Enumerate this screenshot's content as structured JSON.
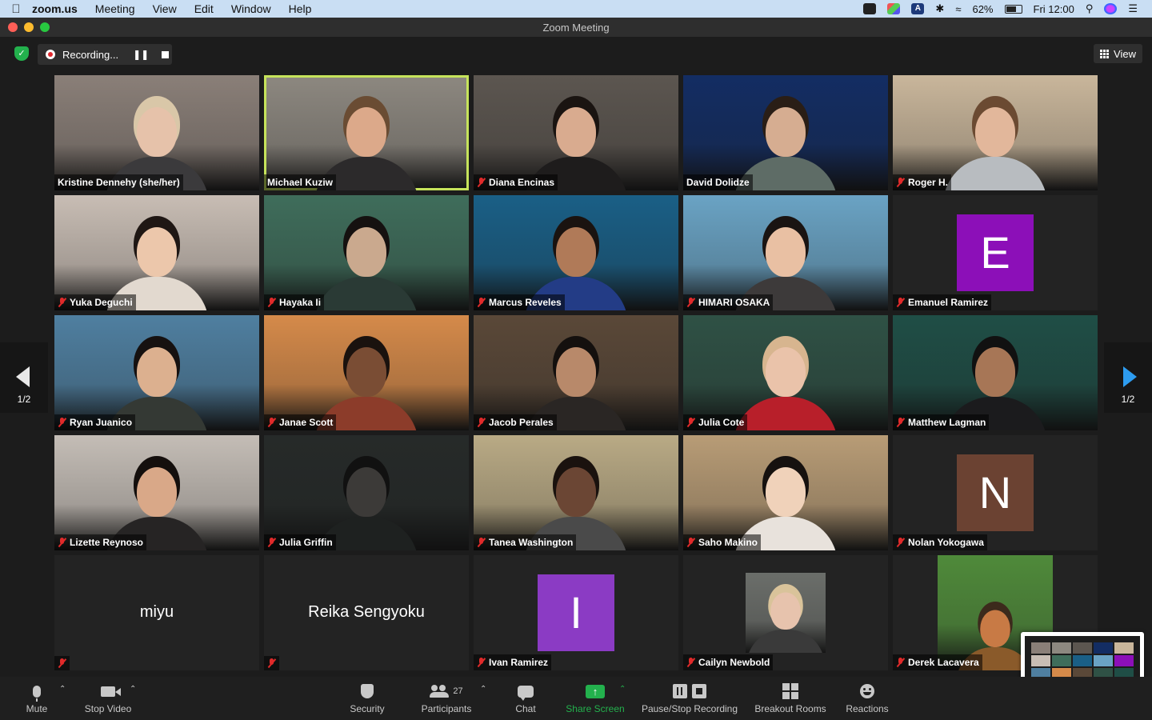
{
  "menubar": {
    "app_name": "zoom.us",
    "menus": [
      "Meeting",
      "View",
      "Edit",
      "Window",
      "Help"
    ],
    "battery_text": "62%",
    "clock": "Fri 12:00",
    "a_icon_text": "A"
  },
  "window": {
    "title": "Zoom Meeting"
  },
  "topbar": {
    "recording_label": "Recording...",
    "view_label": "View"
  },
  "pager": {
    "left_label": "1/2",
    "right_label": "1/2"
  },
  "participants": [
    {
      "name": "Kristine Dennehy (she/her)",
      "muted": false,
      "type": "video",
      "bg": "#8a7f78",
      "skin": "#e6c2aa",
      "shirt": "#3b3a3c",
      "hair": "#d9c7a8"
    },
    {
      "name": "Michael Kuziw",
      "muted": false,
      "type": "video",
      "active": true,
      "bg": "#8d8880",
      "skin": "#dca98a",
      "shirt": "#2c2a2b",
      "hair": "#6a4c33"
    },
    {
      "name": "Diana Encinas",
      "muted": true,
      "type": "video",
      "bg": "#5c5650",
      "skin": "#d9ab8f",
      "shirt": "#1e1c1c",
      "hair": "#1a1411"
    },
    {
      "name": "David Dolidze",
      "muted": false,
      "type": "video",
      "bg": "#132d63",
      "skin": "#d6ad91",
      "shirt": "#5e6c66",
      "hair": "#2a1e16"
    },
    {
      "name": "Roger H.",
      "muted": true,
      "type": "video",
      "bg": "#c9b69b",
      "skin": "#e2b79b",
      "shirt": "#b8bcc0",
      "hair": "#6b4a32"
    },
    {
      "name": "Yuka Deguchi",
      "muted": true,
      "type": "video",
      "bg": "#c8bdb4",
      "skin": "#ecc7ab",
      "shirt": "#e2d9cf",
      "hair": "#1f1714"
    },
    {
      "name": "Hayaka Ii",
      "muted": true,
      "type": "video",
      "bg": "#3f6d5b",
      "skin": "#caa98e",
      "shirt": "#2a3a35",
      "hair": "#151110"
    },
    {
      "name": "Marcus Reveles",
      "muted": true,
      "type": "video",
      "bg": "#1a5f86",
      "skin": "#b07a58",
      "shirt": "#233c86",
      "hair": "#1a1310"
    },
    {
      "name": "HIMARI OSAKA",
      "muted": true,
      "type": "video",
      "bg": "#6aa3c4",
      "skin": "#e9c0a3",
      "shirt": "#3d3a3a",
      "hair": "#1a1412"
    },
    {
      "name": "Emanuel Ramirez",
      "muted": true,
      "type": "avatar",
      "letter": "E",
      "color": "#8c0fb8"
    },
    {
      "name": "Ryan Juanico",
      "muted": true,
      "type": "video",
      "bg": "#4f7fa0",
      "skin": "#dcb08f",
      "shirt": "#343934",
      "hair": "#161110"
    },
    {
      "name": "Janae Scott",
      "muted": true,
      "type": "video",
      "bg": "#d58a4a",
      "skin": "#7a4d34",
      "shirt": "#8c3c2a",
      "hair": "#1a120e"
    },
    {
      "name": "Jacob Perales",
      "muted": true,
      "type": "video",
      "bg": "#5a4838",
      "skin": "#b8896a",
      "shirt": "#2a2624",
      "hair": "#14100e"
    },
    {
      "name": "Julia Cote",
      "muted": true,
      "type": "video",
      "bg": "#2f5145",
      "skin": "#eac3aa",
      "shirt": "#b81f2a",
      "hair": "#d7b58f"
    },
    {
      "name": "Matthew Lagman",
      "muted": true,
      "type": "video",
      "bg": "#1f4e46",
      "skin": "#a77656",
      "shirt": "#1b1b1d",
      "hair": "#111"
    },
    {
      "name": "Lizette Reynoso",
      "muted": true,
      "type": "video",
      "bg": "#c4bdb6",
      "skin": "#d9a888",
      "shirt": "#262424",
      "hair": "#140f0d"
    },
    {
      "name": "Julia Griffin",
      "muted": true,
      "type": "video",
      "bg": "#262a29",
      "skin": "#3c3a38",
      "shirt": "#1e2120",
      "hair": "#111"
    },
    {
      "name": "Tanea Washington",
      "muted": true,
      "type": "video",
      "bg": "#b9aa85",
      "skin": "#6b4634",
      "shirt": "#4a4a4a",
      "hair": "#1a120e"
    },
    {
      "name": "Saho Makino",
      "muted": true,
      "type": "video",
      "bg": "#b89c76",
      "skin": "#f0d2ba",
      "shirt": "#e8e2dc",
      "hair": "#16110f"
    },
    {
      "name": "Nolan Yokogawa",
      "muted": true,
      "type": "avatar",
      "letter": "N",
      "color": "#6b4232"
    },
    {
      "name": "miyu",
      "muted": true,
      "type": "name-only"
    },
    {
      "name": "Reika Sengyoku",
      "muted": true,
      "type": "name-only"
    },
    {
      "name": "Ivan Ramirez",
      "muted": true,
      "type": "avatar",
      "letter": "I",
      "color": "#8b3bc4"
    },
    {
      "name": "Cailyn Newbold",
      "muted": true,
      "type": "photo",
      "bg": "#6b6e6a",
      "skin": "#e7c3ad",
      "shirt": "#3a3a3a",
      "hair": "#d9c39a"
    },
    {
      "name": "Derek Lacavera",
      "muted": true,
      "type": "photo",
      "bg": "#4f8a3a",
      "skin": "#c87a45",
      "shirt": "#8a5a2a",
      "hair": "#3c2a1c"
    }
  ],
  "toolbar": {
    "mute": "Mute",
    "stop_video": "Stop Video",
    "security": "Security",
    "participants": "Participants",
    "participants_count": "27",
    "chat": "Chat",
    "share_screen": "Share Screen",
    "pause_stop_recording": "Pause/Stop Recording",
    "breakout_rooms": "Breakout Rooms",
    "reactions": "Reactions"
  },
  "colors": {
    "active_speaker": "#c6e35b",
    "share_green": "#23b14d",
    "pager_arrow": "#2d9cf0",
    "muted_red": "#e02a2a"
  }
}
